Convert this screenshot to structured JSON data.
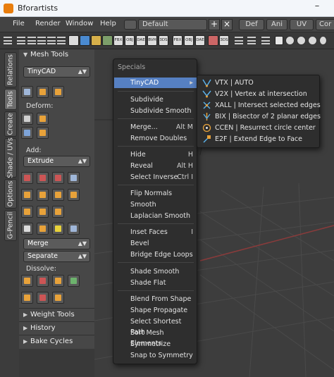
{
  "window": {
    "title": "Bforartists",
    "minimize": "–"
  },
  "menubar": {
    "items": [
      "File",
      "Render",
      "Window",
      "Help"
    ],
    "layout": "Default",
    "add": "+",
    "close": "×",
    "tabs": [
      "Def",
      "Ani",
      "UV",
      "Cor"
    ]
  },
  "toolbar": {
    "labels": [
      "FBX",
      "OBJ",
      "DAE",
      "BVH",
      "3DS",
      "FBX",
      "OBJ",
      "DAE",
      "3DS"
    ]
  },
  "vtabs": [
    "Relations",
    "Tools",
    "Create",
    "Shade / UVs",
    "Options",
    "G-Pencil"
  ],
  "panel": {
    "mesh_tools": "Mesh Tools",
    "tinycad_select": "TinyCAD",
    "deform_label": "Deform:",
    "add_label": "Add:",
    "extrude_select": "Extrude",
    "merge_select": "Merge",
    "separate_select": "Separate",
    "dissolve_label": "Dissolve:",
    "weight_tools": "Weight Tools",
    "history": "History",
    "bake_cycles": "Bake Cycles"
  },
  "specials": {
    "title": "Specials",
    "items": [
      {
        "label": "TinyCAD",
        "shortcut": "▸"
      },
      {
        "label": "Subdivide",
        "shortcut": ""
      },
      {
        "label": "Subdivide Smooth",
        "shortcut": ""
      },
      {
        "label": "Merge...",
        "shortcut": "Alt M"
      },
      {
        "label": "Remove Doubles",
        "shortcut": ""
      },
      {
        "label": "Hide",
        "shortcut": "H"
      },
      {
        "label": "Reveal",
        "shortcut": "Alt H"
      },
      {
        "label": "Select Inverse",
        "shortcut": "Ctrl I"
      },
      {
        "label": "Flip Normals",
        "shortcut": ""
      },
      {
        "label": "Smooth",
        "shortcut": ""
      },
      {
        "label": "Laplacian Smooth",
        "shortcut": ""
      },
      {
        "label": "Inset Faces",
        "shortcut": "I"
      },
      {
        "label": "Bevel",
        "shortcut": ""
      },
      {
        "label": "Bridge Edge Loops",
        "shortcut": ""
      },
      {
        "label": "Shade Smooth",
        "shortcut": ""
      },
      {
        "label": "Shade Flat",
        "shortcut": ""
      },
      {
        "label": "Blend From Shape",
        "shortcut": ""
      },
      {
        "label": "Shape Propagate",
        "shortcut": ""
      },
      {
        "label": "Select Shortest Path",
        "shortcut": ""
      },
      {
        "label": "Sort Mesh Elements",
        "shortcut": ""
      },
      {
        "label": "Symmetrize",
        "shortcut": ""
      },
      {
        "label": "Snap to Symmetry",
        "shortcut": ""
      }
    ]
  },
  "tinycad_submenu": {
    "items": [
      {
        "label": "VTX | AUTO",
        "icon": "vtx-icon"
      },
      {
        "label": "V2X | Vertex at intersection",
        "icon": "v2x-icon"
      },
      {
        "label": "XALL | Intersect selected edges",
        "icon": "xall-icon"
      },
      {
        "label": "BIX | Bisector of 2 planar edges",
        "icon": "bix-icon"
      },
      {
        "label": "CCEN | Resurrect circle center",
        "icon": "ccen-icon"
      },
      {
        "label": "E2F | Extend Edge to Face",
        "icon": "e2f-icon"
      }
    ]
  },
  "colors": {
    "highlight": "#5680c2",
    "menu_bg": "#2e2e2e",
    "panel_bg": "#474747",
    "viewport_bg": "#3d3d3d",
    "accent_orange": "#e8a23a"
  }
}
